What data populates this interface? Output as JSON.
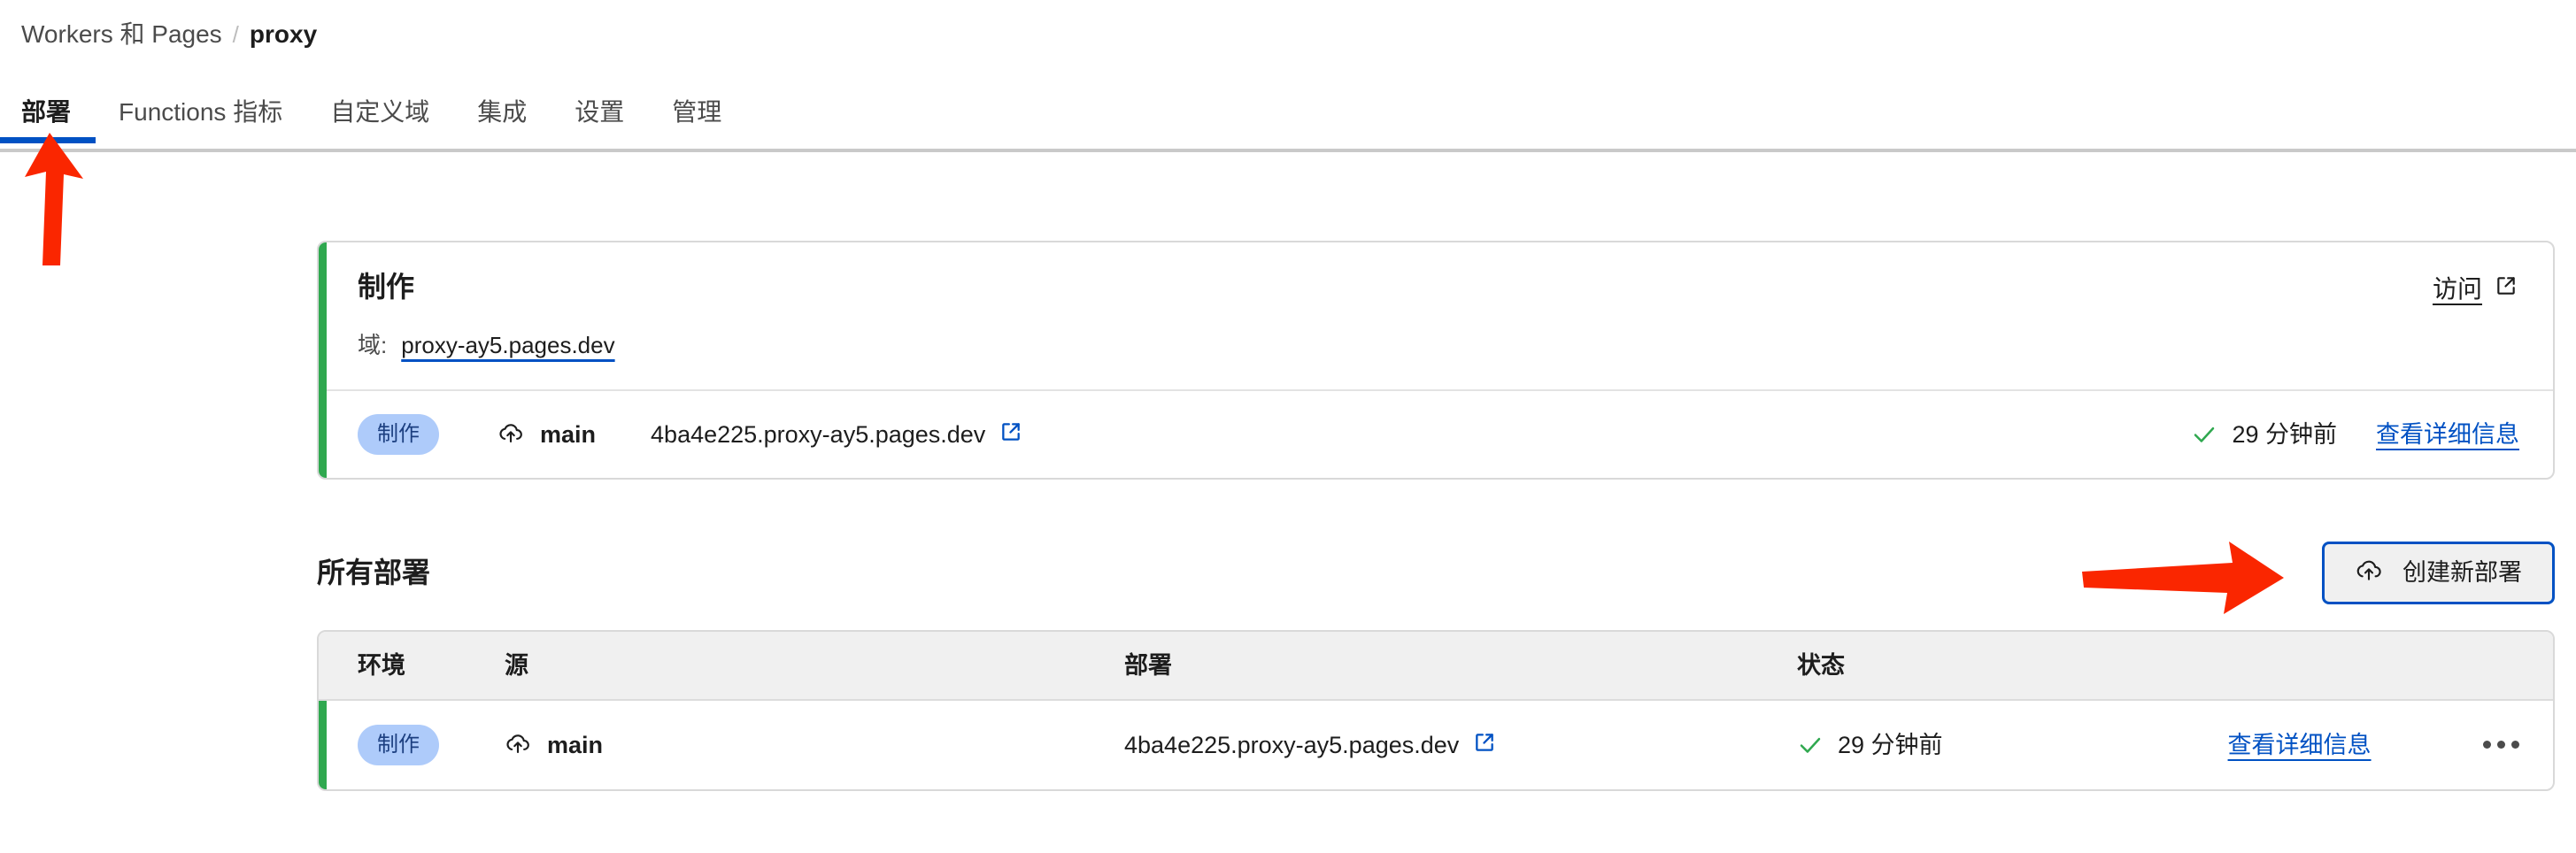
{
  "breadcrumb": {
    "parent": "Workers 和 Pages",
    "separator": "/",
    "current": "proxy"
  },
  "tabs": [
    {
      "label": "部署",
      "active": true
    },
    {
      "label": "Functions 指标",
      "active": false
    },
    {
      "label": "自定义域",
      "active": false
    },
    {
      "label": "集成",
      "active": false
    },
    {
      "label": "设置",
      "active": false
    },
    {
      "label": "管理",
      "active": false
    }
  ],
  "production_card": {
    "title": "制作",
    "domain_label": "域:",
    "domain_value": "proxy-ay5.pages.dev",
    "visit_label": "访问",
    "visit_icon": "external-link-icon",
    "accent_color": "#2fa84f",
    "deployment": {
      "environment_badge": "制作",
      "badge_bg": "#aecbfa",
      "badge_fg": "#1c3f80",
      "source_icon": "cloud-upload-icon",
      "branch": "main",
      "url": "4ba4e225.proxy-ay5.pages.dev",
      "url_icon": "external-link-icon",
      "status_icon": "check-icon",
      "status_color": "#2fa84f",
      "time": "29 分钟前",
      "details_label": "查看详细信息"
    }
  },
  "all_deployments": {
    "title": "所有部署",
    "create_button": {
      "label": "创建新部署",
      "icon": "cloud-upload-icon",
      "border_color": "#0051c3",
      "background": "#f0f0f0"
    },
    "columns": [
      "环境",
      "源",
      "部署",
      "状态"
    ],
    "rows": [
      {
        "environment": "制作",
        "source_icon": "cloud-upload-icon",
        "branch": "main",
        "deployment_url": "4ba4e225.proxy-ay5.pages.dev",
        "deployment_icon": "external-link-icon",
        "status_icon": "check-icon",
        "status_time": "29 分钟前",
        "details_label": "查看详细信息",
        "actions_icon": "kebab-menu-icon"
      }
    ]
  },
  "annotations": {
    "arrow_color": "#fa2600",
    "arrow_tab": "points-up-at-active-tab",
    "arrow_button": "points-right-at-create-deployment-button"
  },
  "theme": {
    "link_blue": "#0051c3",
    "success_green": "#2fa84f",
    "border_gray": "#d9d9d9",
    "header_gray": "#f0f0f0"
  }
}
